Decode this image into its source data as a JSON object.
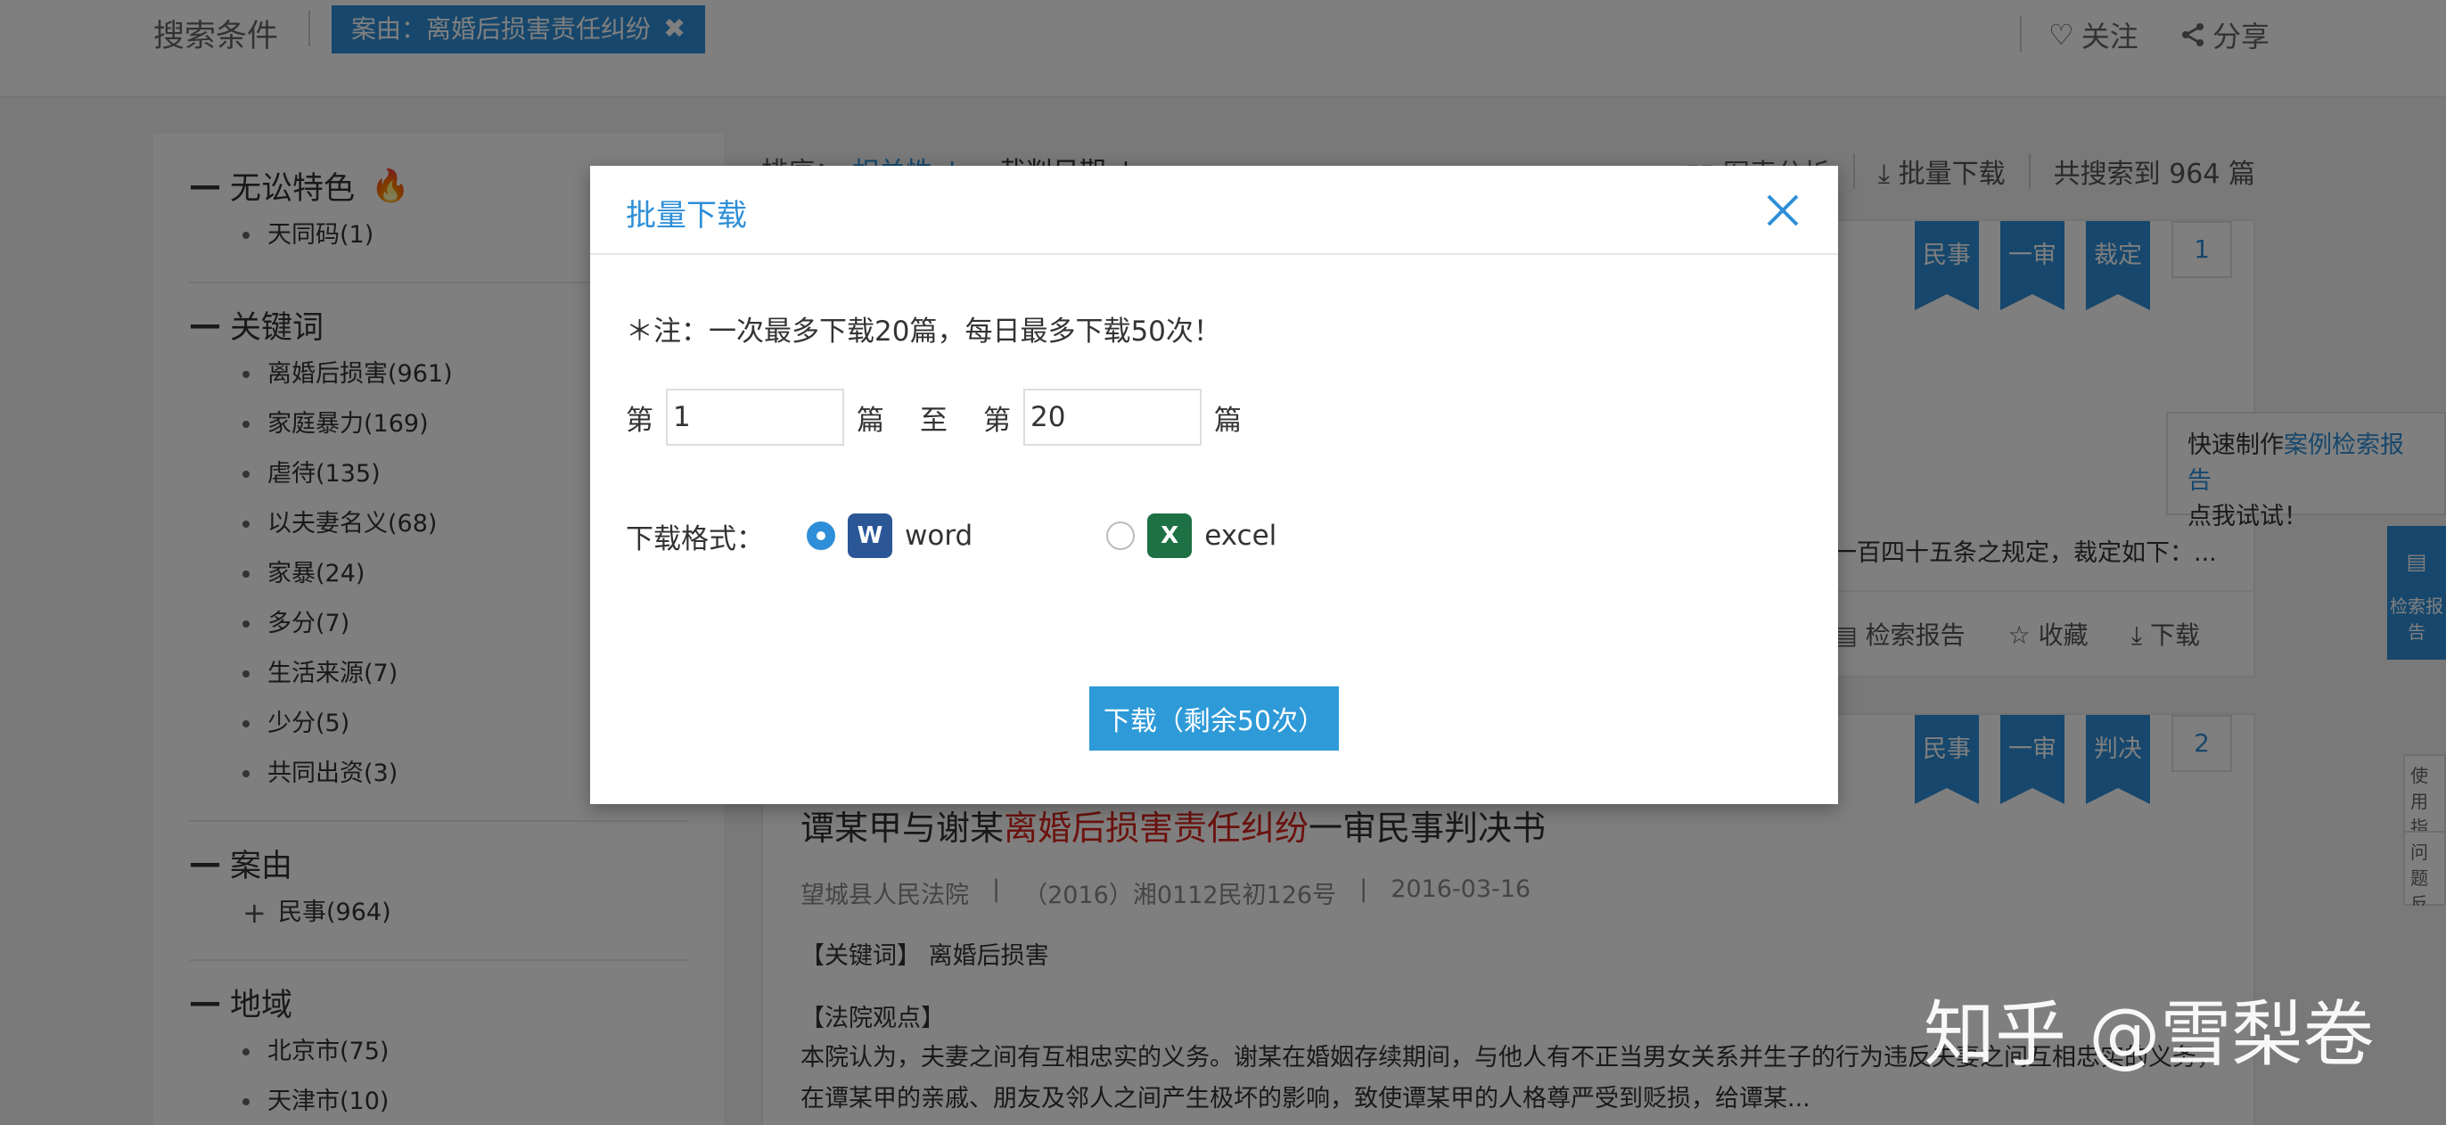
{
  "top": {
    "search_label": "搜索条件",
    "condition_tag": "案由：离婚后损害责任纠纷",
    "follow": "关注",
    "share": "分享"
  },
  "sidebar": {
    "facets": [
      {
        "title": "无讼特色",
        "items": [
          "天同码(1)"
        ]
      },
      {
        "title": "关键词",
        "items": [
          "离婚后损害(961)",
          "家庭暴力(169)",
          "虐待(135)",
          "以夫妻名义(68)",
          "家暴(24)",
          "多分(7)",
          "生活来源(7)",
          "少分(5)",
          "共同出资(3)"
        ]
      },
      {
        "title": "案由",
        "items": [
          "民事(964)"
        ]
      },
      {
        "title": "地域",
        "items": [
          "北京市(75)",
          "天津市(10)"
        ]
      }
    ]
  },
  "sortbar": {
    "label": "排序：",
    "relevance": "相关性",
    "date": "裁判日期",
    "chart_analysis": "图表分析",
    "batch_download": "批量下载",
    "total": "共搜索到 964 篇"
  },
  "result1": {
    "tags": [
      "民事",
      "一审",
      "裁定"
    ],
    "index": "1",
    "snippet": "一百四十五条之规定，裁定如下：...",
    "actions": {
      "report": "检索报告",
      "collect": "收藏",
      "download": "下载"
    }
  },
  "result2": {
    "tags": [
      "民事",
      "一审",
      "判决"
    ],
    "index": "2",
    "title_pre": "谭某甲与谢某",
    "title_hl": "离婚后损害责任纠纷",
    "title_post": "一审民事判决书",
    "court": "望城县人民法院",
    "case_no": "（2016）湘0112民初126号",
    "date": "2016-03-16",
    "keywords": "【关键词】 离婚后损害",
    "view_label": "【法院观点】",
    "body": "本院认为，夫妻之间有互相忠实的义务。谢某在婚姻存续期间，与他人有不正当男女关系并生子的行为违反夫妻之间互相忠实的义务，在谭某甲的亲戚、朋友及邻人之间产生极坏的影响，致使谭某甲的人格尊严受到贬损，给谭某..."
  },
  "promo": {
    "text1": "快速制作",
    "link": "案例检索报告",
    "text2": "点我试试！"
  },
  "float": {
    "report": "检索报告"
  },
  "guide": {
    "use": "使用指南",
    "feedback": "问题反馈"
  },
  "modal": {
    "title": "批量下载",
    "note": "＊注：一次最多下载20篇，每日最多下载50次！",
    "from_prefix": "第",
    "from_value": "1",
    "from_suffix": "篇",
    "to_word": "至",
    "to_prefix": "第",
    "to_value": "20",
    "to_suffix": "篇",
    "format_label": "下载格式：",
    "opt_word": "word",
    "opt_excel": "excel",
    "download_btn": "下载（剩余50次）"
  },
  "watermark": "知乎 @雪梨卷",
  "colors": {
    "accent": "#2e8fd8",
    "highlight": "#d9251c",
    "word": "#2b5797",
    "excel": "#1e7145"
  }
}
